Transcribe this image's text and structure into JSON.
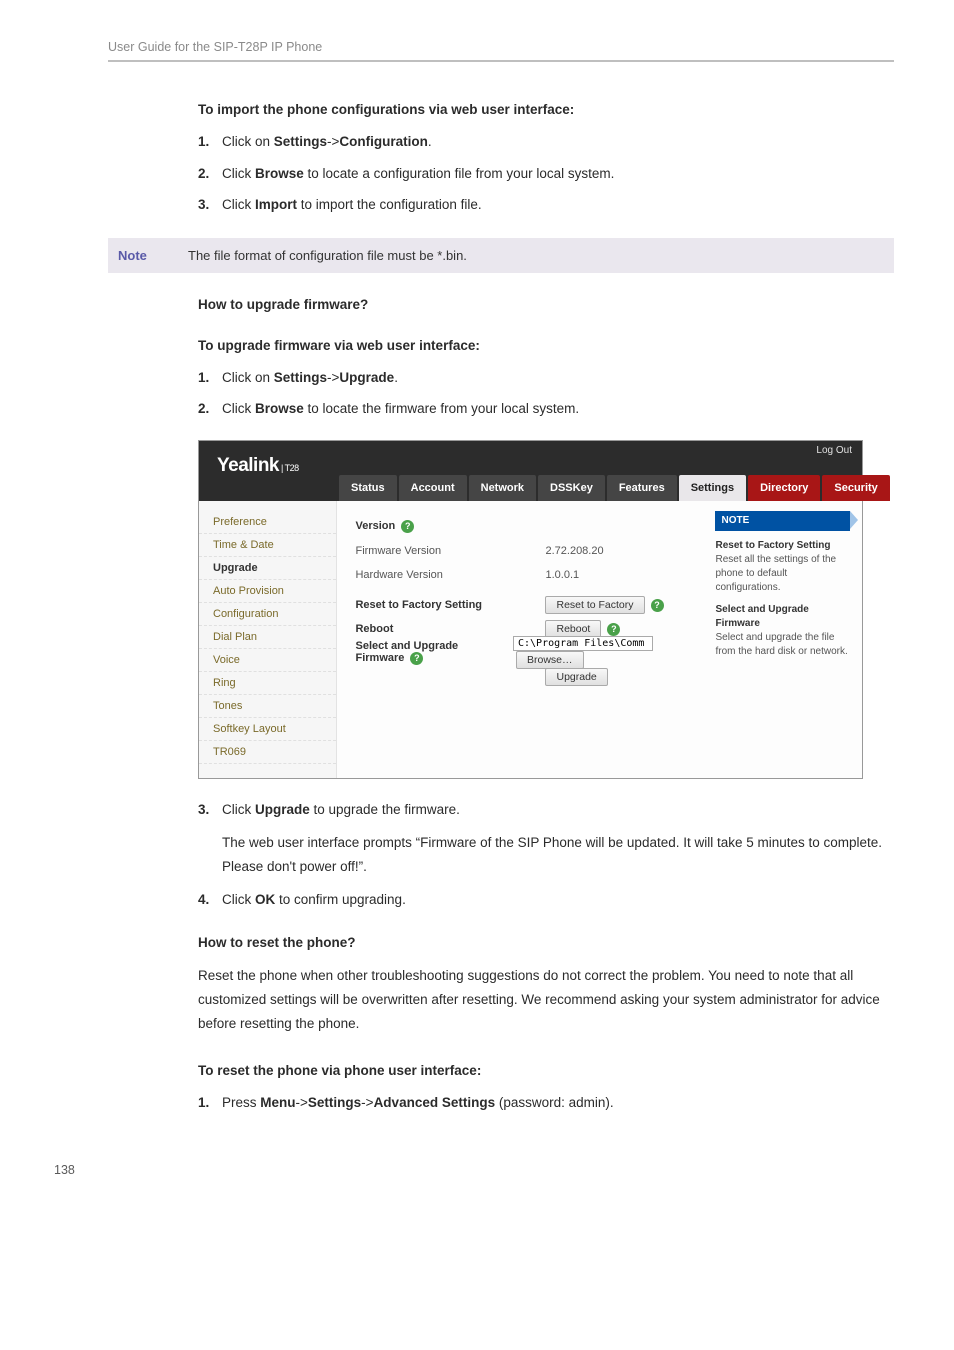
{
  "header": "User Guide for the SIP-T28P IP Phone",
  "section1_title": "To import the phone configurations via web user interface:",
  "steps1": [
    {
      "n": "1.",
      "before": "Click on ",
      "b1": "Settings",
      "mid": "->",
      "b2": "Configuration",
      "after": "."
    },
    {
      "n": "2.",
      "before": "Click ",
      "b1": "Browse",
      "mid": "",
      "b2": "",
      "after": " to locate a configuration file from your local system."
    },
    {
      "n": "3.",
      "before": "Click ",
      "b1": "Import",
      "mid": "",
      "b2": "",
      "after": " to import the configuration file."
    }
  ],
  "note_label": "Note",
  "note_text": "The file format of configuration file must be *.bin.",
  "q_upgrade": "How to upgrade firmware?",
  "section2_title": "To upgrade firmware via web user interface:",
  "steps2": [
    {
      "n": "1.",
      "before": "Click on ",
      "b1": "Settings",
      "mid": "->",
      "b2": "Upgrade",
      "after": "."
    },
    {
      "n": "2.",
      "before": "Click ",
      "b1": "Browse",
      "mid": "",
      "b2": "",
      "after": " to locate the firmware from your local system."
    }
  ],
  "webshot": {
    "logo": "Yealink",
    "logo_sub": "| T28",
    "logout": "Log Out",
    "tabs": [
      "Status",
      "Account",
      "Network",
      "DSSKey",
      "Features",
      "Settings",
      "Directory",
      "Security"
    ],
    "active_tab": 5,
    "sidebar": [
      "Preference",
      "Time & Date",
      "Upgrade",
      "Auto Provision",
      "Configuration",
      "Dial Plan",
      "Voice",
      "Ring",
      "Tones",
      "Softkey Layout",
      "TR069"
    ],
    "sidebar_sel": 2,
    "version_label": "Version",
    "fw_label": "Firmware Version",
    "fw_val": "2.72.208.20",
    "hw_label": "Hardware Version",
    "hw_val": "1.0.0.1",
    "reset_label": "Reset to Factory Setting",
    "reset_btn": "Reset to Factory",
    "reboot_label": "Reboot",
    "reboot_btn": "Reboot",
    "upgrade_label": "Select and Upgrade Firmware",
    "upgrade_input": "C:\\Program Files\\Comm",
    "browse_btn": "Browse…",
    "upgrade_btn": "Upgrade",
    "help_q": "?",
    "note_h": "NOTE",
    "note1_t": "Reset to Factory Setting",
    "note1_p": "Reset all the settings of the phone to default configurations.",
    "note2_t": "Select and Upgrade Firmware",
    "note2_p": "Select and upgrade the file from the hard disk or network."
  },
  "steps3": [
    {
      "n": "3.",
      "before": "Click ",
      "b1": "Upgrade",
      "after": " to upgrade the firmware."
    }
  ],
  "step3_extra": "The web user interface prompts “Firmware of the SIP Phone will be updated. It will take 5 minutes to complete. Please don't power off!”.",
  "steps4": [
    {
      "n": "4.",
      "before": "Click ",
      "b1": "OK",
      "after": " to confirm upgrading."
    }
  ],
  "q_reset": "How to reset the phone?",
  "reset_para": "Reset the phone when other troubleshooting suggestions do not correct the problem. You need to note that all customized settings will be overwritten after resetting. We recommend asking your system administrator for advice before resetting the phone.",
  "section3_title": "To reset the phone via phone user interface:",
  "steps5": [
    {
      "n": "1.",
      "before": "Press ",
      "b1": "Menu",
      "mid1": "->",
      "b2": "Settings",
      "mid2": "->",
      "b3": "Advanced Settings",
      "after": " (password: admin)."
    }
  ],
  "page_num": "138"
}
